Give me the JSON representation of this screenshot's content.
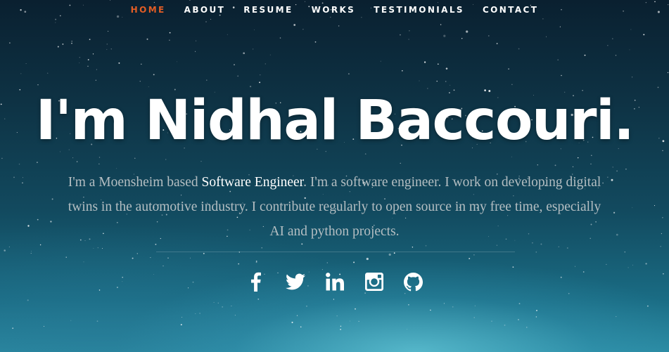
{
  "nav": {
    "items": [
      {
        "label": "HOME",
        "active": true
      },
      {
        "label": "ABOUT"
      },
      {
        "label": "RESUME"
      },
      {
        "label": "WORKS"
      },
      {
        "label": "TESTIMONIALS"
      },
      {
        "label": "CONTACT"
      }
    ]
  },
  "hero": {
    "title": "I'm Nidhal Baccouri.",
    "bio": {
      "before": "I'm a Moensheim based ",
      "role": "Software Engineer",
      "after": ". I'm a software engineer. I work on developing digital twins in the automotive industry. I contribute regularly to open source in my free time, especially AI and python projects."
    }
  },
  "social": [
    "facebook-icon",
    "twitter-icon",
    "linkedin-icon",
    "instagram-icon",
    "github-icon"
  ],
  "colors": {
    "accent": "#e25d25",
    "text": "#ffffff",
    "muted": "#b4bec2"
  }
}
